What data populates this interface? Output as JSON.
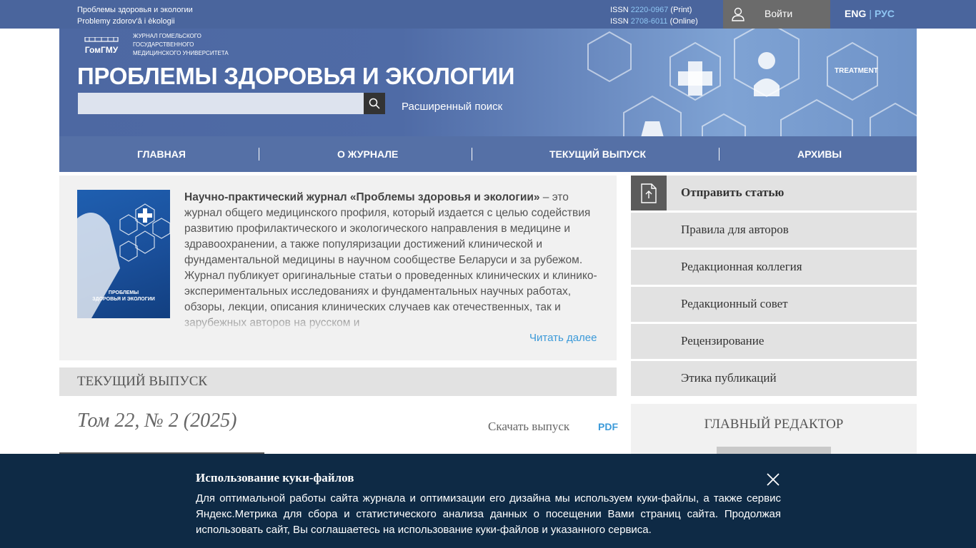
{
  "topbar": {
    "site_name_ru": "Проблемы здоровья и экологии",
    "site_name_lat": "Problemy zdorov'â i èkologii",
    "issn_print_label": "ISSN",
    "issn_print": "2220-0967",
    "issn_print_kind": "(Print)",
    "issn_online_label": "ISSN",
    "issn_online": "2708-6011",
    "issn_online_kind": "(Online)",
    "login_label": "Войти",
    "lang_active": "ENG",
    "lang_sep": "|",
    "lang_other": "РУС"
  },
  "header": {
    "logo_text": "ГомГМУ",
    "university_line1": "ЖУРНАЛ ГОМЕЛЬСКОГО",
    "university_line2": "ГОСУДАРСТВЕННОГО",
    "university_line3": "МЕДИЦИНСКОГО УНИВЕРСИТЕТА",
    "title": "ПРОБЛЕМЫ ЗДОРОВЬЯ И ЭКОЛОГИИ",
    "search_placeholder": "",
    "advanced_search": "Расширенный поиск",
    "deco_treatment": "TREATMENT"
  },
  "nav": {
    "items": [
      "Главная",
      "О журнале",
      "Текущий выпуск",
      "Архивы"
    ]
  },
  "about": {
    "lead_bold": "Научно-практический журнал «Проблемы здоровья и экологии»",
    "text": " – это журнал общего медицинского профиля, который издается с целью содействия развитию профилактического и экологического направления в медицине и здравоохранении, а также популяризации достижений клинической и фундаментальной медицины в научном сообществе Беларуси и за рубежом. Журнал публикует оригинальные статьи о проведенных клинических и клинико-экспериментальных исследованиях и фундаментальных научных работах, обзоры, лекции, описания клинических случаев как отечественных, так и зарубежных авторов на русском и",
    "read_more": "Читать далее",
    "cover_title_line1": "ПРОБЛЕМЫ",
    "cover_title_line2": "ЗДОРОВЬЯ И ЭКОЛОГИИ"
  },
  "current_issue": {
    "heading": "Текущий выпуск",
    "title": "Том 22, № 2 (2025)",
    "download_label": "Скачать выпуск",
    "pdf_label": "PDF"
  },
  "sidebar": {
    "items": [
      "Отправить статью",
      "Правила для авторов",
      "Редакционная коллегия",
      "Редакционный совет",
      "Рецензирование",
      "Этика публикаций"
    ],
    "editor_heading": "Главный редактор"
  },
  "cookie": {
    "title": "Использование куки-файлов",
    "text": "Для оптимальной работы сайта журнала и оптимизации его дизайна мы используем куки-файлы, а также сервис Яндекс.Метрика для сбора и статистического анализа данных о посещении Вами страниц сайта. Продолжая использовать сайт, Вы соглашаетесь на использование куки-файлов и указанного сервиса."
  },
  "colors": {
    "topbar": "#4a659d",
    "accent_link": "#3b9ad9",
    "cookie_bg": "#0e2a45",
    "menu_bg": "#e2e2e2"
  }
}
